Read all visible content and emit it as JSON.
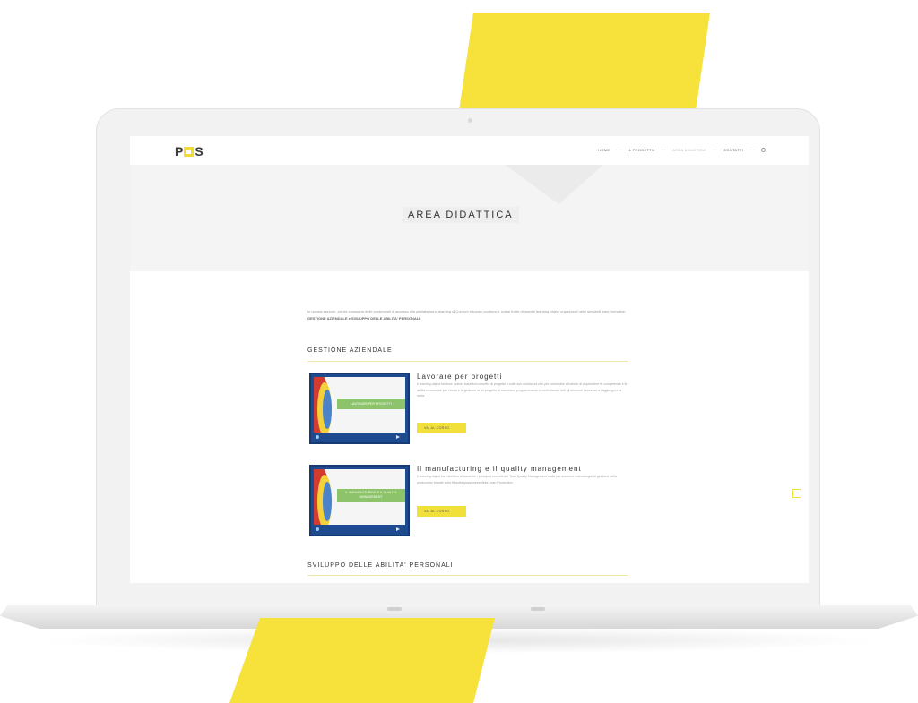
{
  "colors": {
    "accent_yellow": "#f7e13b",
    "button_yellow": "#f2e03a",
    "thumb_blue": "#1e4a8f",
    "band_green": "#8dc36b"
  },
  "header": {
    "logo_left": "P",
    "logo_right": "S",
    "nav": [
      "HOME",
      "IL PROGETTO",
      "AREA DIDATTICA",
      "CONTATTI"
    ],
    "search_icon": "search-icon"
  },
  "hero": {
    "title": "AREA DIDATTICA"
  },
  "intro": {
    "text": "In questa sezione, previa consegna delle credenziali di accesso alla piattaforma e-learning di Confore educare conform.it, potrai fruire di numeri learning object organizzati nelle seguenti aree formative:",
    "highlight": "GESTIONE AZIENDALE e SVILUPPO DELLE ABILITA' PERSONALI."
  },
  "sections": [
    {
      "title": "GESTIONE AZIENDALE",
      "courses": [
        {
          "thumb_label": "LAVORARE PER PROGETTI",
          "title": "Lavorare per progetti",
          "description": "Il learning object fornisce nozioni base sul concetto di progetto e sulle sue condizioni che per consentire all'utente di apprendere le competenze e le abilità necessarie per l'avvio e la gestione di un progetto di successo, programmando e controllando tutti gli elementi necessari a raggiungere la meta.",
          "button": "VAI AL CORSO"
        },
        {
          "thumb_label": "IL MANUFACTURING E IL QUALITY MANAGEMENT",
          "title": "Il manufacturing e il quality management",
          "description": "Il learning object ha l'obiettivo di trasferire i principali concetti del Total Quality Management e alle più moderne metodologie di gestione della produzione basate sulla filosofia giapponese della Lean Production.",
          "button": "VAI AL CORSO"
        }
      ]
    },
    {
      "title": "SVILUPPO DELLE ABILITA' PERSONALI"
    }
  ]
}
